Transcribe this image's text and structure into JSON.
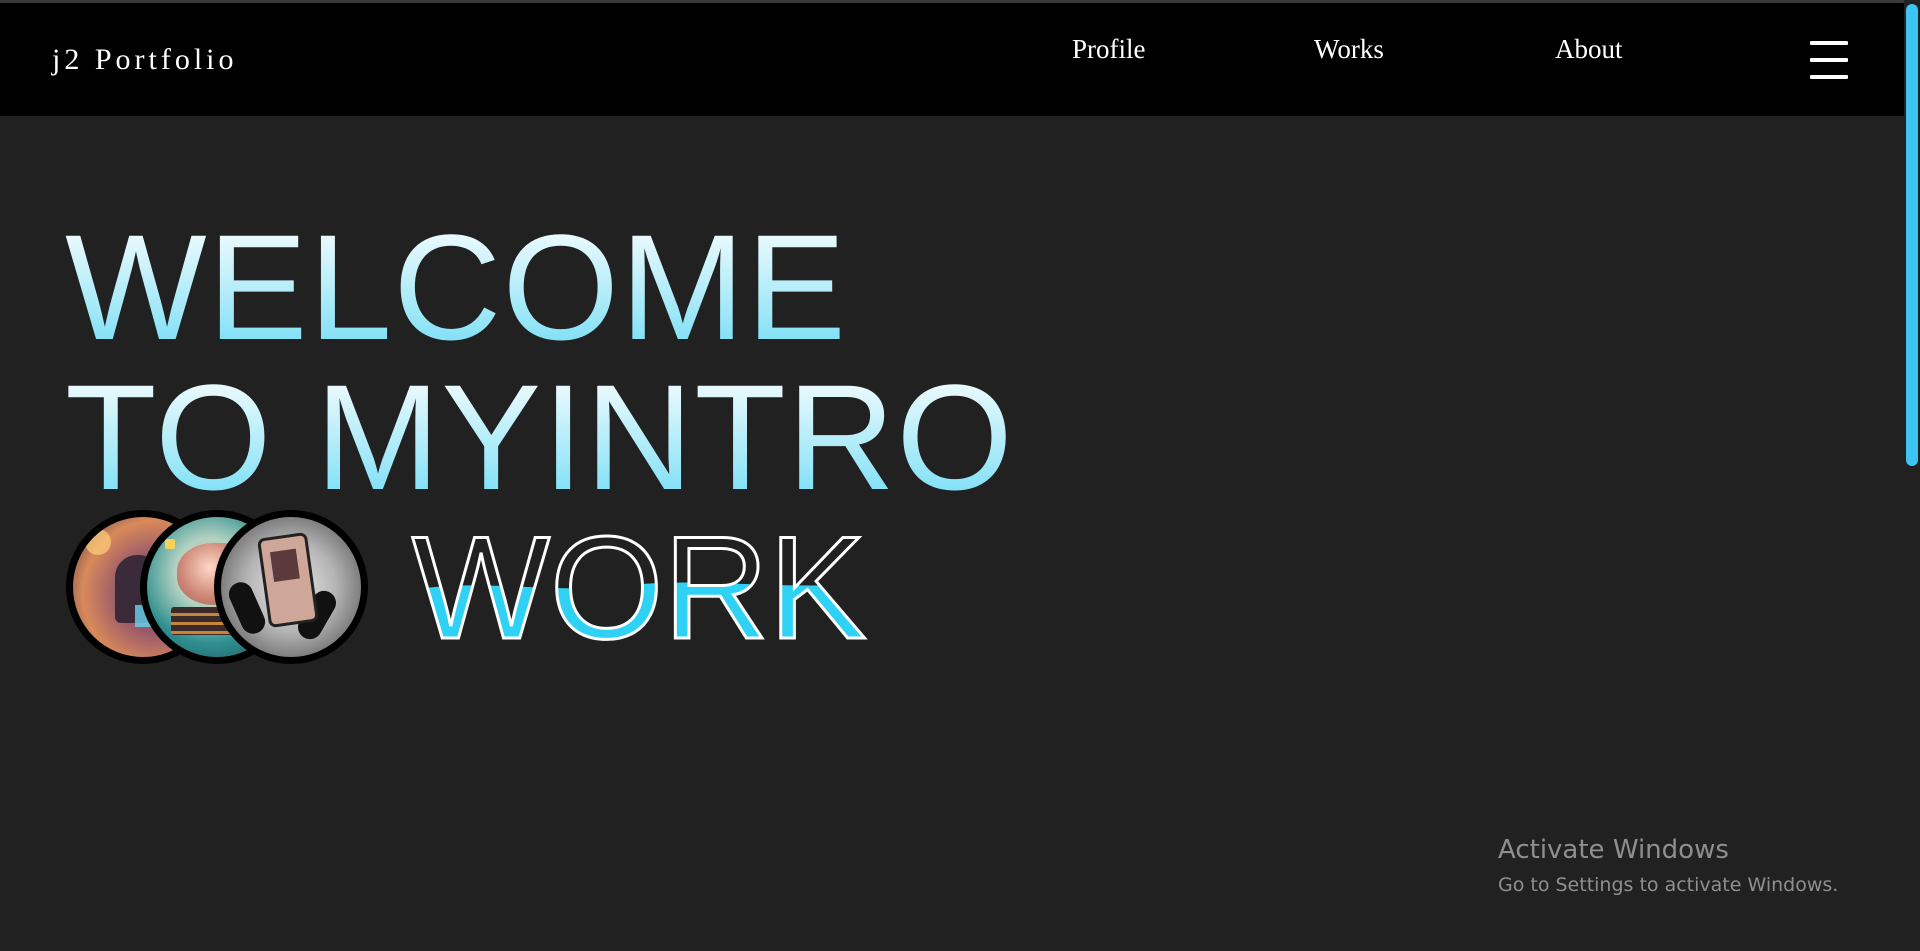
{
  "navbar": {
    "brand": "j2 Portfolio",
    "links": [
      {
        "label": "Profile"
      },
      {
        "label": "Works"
      },
      {
        "label": "About"
      }
    ],
    "menu_icon": "hamburger-menu-icon"
  },
  "hero": {
    "line1": "WELCOME",
    "line2": "TO MYINTRO",
    "line3": "WORK",
    "avatars": [
      "developer-illustration",
      "brain-books-illustration",
      "phone-headphones-photo"
    ]
  },
  "os_overlay": {
    "title": "Activate Windows",
    "subtitle": "Go to Settings to activate Windows."
  },
  "colors": {
    "background": "#212121",
    "navbar": "#000000",
    "accent": "#3cc5f2",
    "work_fill": "#2fd2f5"
  }
}
